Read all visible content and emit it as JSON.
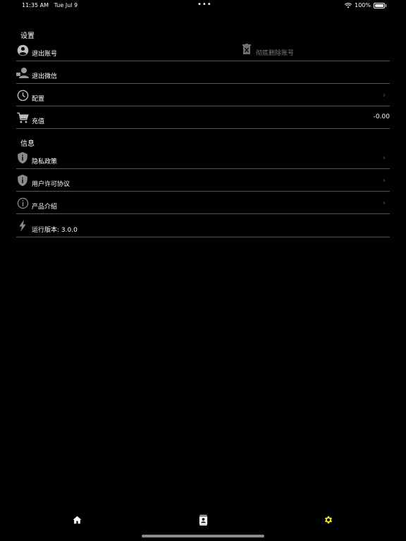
{
  "status_bar": {
    "time": "11:35 AM",
    "date": "Tue Jul 9",
    "dots": "•••",
    "battery_text": "100%"
  },
  "settings": {
    "section_title": "设置",
    "logout_label": "退出账号",
    "delete_account_label": "彻底删除账号",
    "logout_wechat_label": "退出微信",
    "config_label": "配置",
    "recharge_label": "充值",
    "recharge_value": "-0.00"
  },
  "info": {
    "section_title": "信息",
    "privacy_label": "隐私政策",
    "user_agreement_label": "用户许可协议",
    "product_intro_label": "产品介绍",
    "version_label": "运行版本: 3.0.0"
  },
  "chevron": "›",
  "icons": {
    "logout": "account-circle-icon",
    "delete_account": "delete-icon",
    "logout_wechat": "wechat-user-icon",
    "config": "clock-icon",
    "recharge": "cart-icon",
    "privacy": "shield-info-icon",
    "user_agreement": "shield-info-icon",
    "product_intro": "info-circle-icon",
    "version": "lightning-icon",
    "tab_home": "home-icon",
    "tab_contacts": "contact-card-icon",
    "tab_settings": "gear-icon"
  },
  "colors": {
    "background": "#000000",
    "text": "#ffffff",
    "divider": "#555555",
    "active_tab": "#f5e61b",
    "muted": "#7a7a7a"
  }
}
